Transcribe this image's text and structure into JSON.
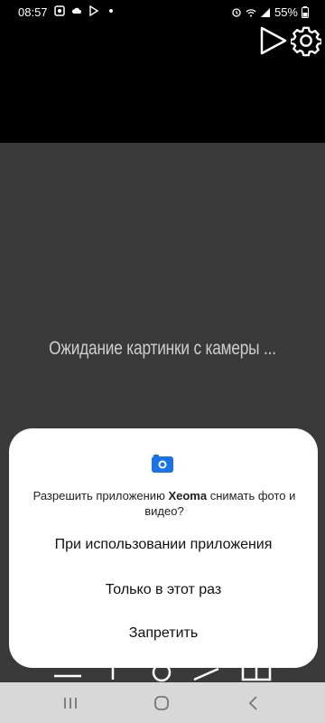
{
  "status": {
    "time": "08:57",
    "battery": "55%"
  },
  "preview": {
    "waiting_text": "Ожидание картинки с камеры ..."
  },
  "dialog": {
    "prompt_prefix": "Разрешить приложению ",
    "app_name": "Xeoma",
    "prompt_suffix": " снимать фото и видео?",
    "options": [
      "При использовании приложения",
      "Только в этот раз",
      "Запретить"
    ]
  }
}
